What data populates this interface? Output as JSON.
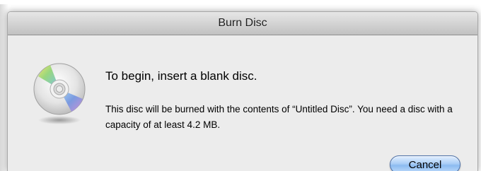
{
  "dialog": {
    "title": "Burn Disc",
    "heading": "To begin, insert a blank disc.",
    "message": "This disc will be burned with the contents of “Untitled Disc”. You need a disc with a capacity of at least 4.2 MB.",
    "cancel_label": "Cancel",
    "icon": "disc-icon"
  },
  "colors": {
    "window_background": "#ececec",
    "button_accent": "#8cbbf0"
  }
}
